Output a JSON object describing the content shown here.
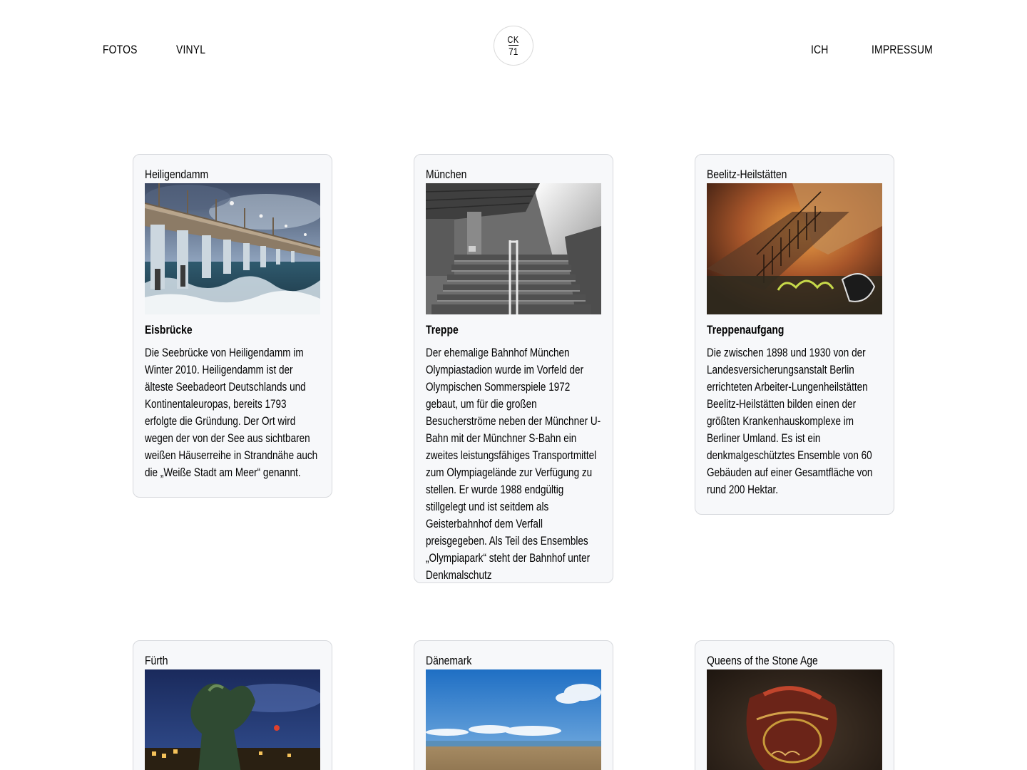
{
  "nav": {
    "left": [
      "FOTOS",
      "VINYL"
    ],
    "right": [
      "ICH",
      "IMPRESSUM"
    ]
  },
  "logo": {
    "line1": "CK",
    "line2": "71"
  },
  "cards": [
    {
      "title": "Heiligendamm",
      "subtitle": "Eisbrücke",
      "text": "Die Seebrücke von Heiligendamm im Winter 2010. Heiligendamm ist der älteste Seebadeort Deutschlands und Kontinentaleuropas, bereits 1793 erfolgte die Gründung. Der Ort wird wegen der von der See aus sichtbaren weißen Häuserreihe in Strandnähe auch die „Weiße Stadt am Meer“ genannt."
    },
    {
      "title": "München",
      "subtitle": "Treppe",
      "text": "Der ehemalige Bahnhof München Olympiastadion wurde im Vorfeld der Olympischen Sommerspiele 1972 gebaut, um für die großen Besucherströme neben der Münchner U-Bahn mit der Münchner S-Bahn ein zweites leistungsfähiges Transportmittel zum Olympiagelände zur Verfügung zu stellen. Er wurde 1988 endgültig stillgelegt und ist seitdem als Geisterbahnhof dem Verfall preisgegeben. Als Teil des Ensembles „Olympiapark“ steht der Bahnhof unter Denkmalschutz"
    },
    {
      "title": "Beelitz-Heilstätten",
      "subtitle": "Treppenaufgang",
      "text": "Die zwischen 1898 und 1930 von der Landesversicherungsanstalt Berlin errichteten Arbeiter-Lungenheilstätten Beelitz-Heilstätten bilden einen der größten Krankenhauskomplexe im Berliner Umland. Es ist ein denkmalgeschütztes Ensemble von 60 Gebäuden auf einer Gesamtfläche von rund 200 Hektar."
    },
    {
      "title": "Fürth"
    },
    {
      "title": "Dänemark"
    },
    {
      "title": "Queens of the Stone Age"
    }
  ]
}
